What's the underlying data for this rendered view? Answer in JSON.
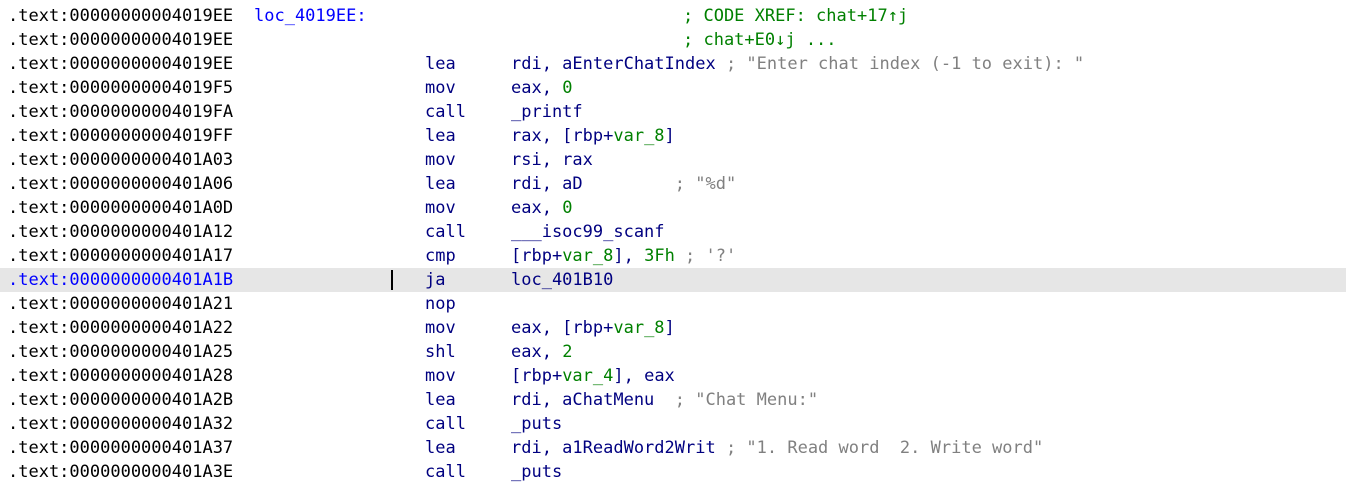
{
  "listing": {
    "rows": [
      {
        "addr": ".text:00000000004019EE",
        "label": "loc_4019EE:",
        "mn": "",
        "ops": [],
        "xref": "; CODE XREF: chat+17↑j"
      },
      {
        "addr": ".text:00000000004019EE",
        "label": "",
        "mn": "",
        "ops": [],
        "xref": "; chat+E0↓j ..."
      },
      {
        "addr": ".text:00000000004019EE",
        "label": "",
        "mn": "lea",
        "ops": [
          [
            "rdi, aEnterChatIndex ",
            "plain"
          ],
          [
            "; \"Enter chat index (-1 to exit): \"",
            "cmt"
          ]
        ],
        "xref": ""
      },
      {
        "addr": ".text:00000000004019F5",
        "label": "",
        "mn": "mov",
        "ops": [
          [
            "eax, ",
            "plain"
          ],
          [
            "0",
            "num"
          ]
        ],
        "xref": ""
      },
      {
        "addr": ".text:00000000004019FA",
        "label": "",
        "mn": "call",
        "ops": [
          [
            "_printf",
            "plain"
          ]
        ],
        "xref": ""
      },
      {
        "addr": ".text:00000000004019FF",
        "label": "",
        "mn": "lea",
        "ops": [
          [
            "rax, [rbp+",
            "plain"
          ],
          [
            "var_8",
            "var"
          ],
          [
            "]",
            "plain"
          ]
        ],
        "xref": ""
      },
      {
        "addr": ".text:0000000000401A03",
        "label": "",
        "mn": "mov",
        "ops": [
          [
            "rsi, rax",
            "plain"
          ]
        ],
        "xref": ""
      },
      {
        "addr": ".text:0000000000401A06",
        "label": "",
        "mn": "lea",
        "ops": [
          [
            "rdi, aD         ",
            "plain"
          ],
          [
            "; \"%d\"",
            "cmt"
          ]
        ],
        "xref": ""
      },
      {
        "addr": ".text:0000000000401A0D",
        "label": "",
        "mn": "mov",
        "ops": [
          [
            "eax, ",
            "plain"
          ],
          [
            "0",
            "num"
          ]
        ],
        "xref": ""
      },
      {
        "addr": ".text:0000000000401A12",
        "label": "",
        "mn": "call",
        "ops": [
          [
            "___isoc99_scanf",
            "plain"
          ]
        ],
        "xref": ""
      },
      {
        "addr": ".text:0000000000401A17",
        "label": "",
        "mn": "cmp",
        "ops": [
          [
            "[rbp+",
            "plain"
          ],
          [
            "var_8",
            "var"
          ],
          [
            "], ",
            "plain"
          ],
          [
            "3Fh",
            "num"
          ],
          [
            " ; '?'",
            "cmt"
          ]
        ],
        "xref": ""
      },
      {
        "addr": ".text:0000000000401A1B",
        "label": "",
        "mn": "ja",
        "ops": [
          [
            "loc_401B10",
            "plain"
          ]
        ],
        "xref": "",
        "selected": true
      },
      {
        "addr": ".text:0000000000401A21",
        "label": "",
        "mn": "nop",
        "ops": [],
        "xref": ""
      },
      {
        "addr": ".text:0000000000401A22",
        "label": "",
        "mn": "mov",
        "ops": [
          [
            "eax, [rbp+",
            "plain"
          ],
          [
            "var_8",
            "var"
          ],
          [
            "]",
            "plain"
          ]
        ],
        "xref": ""
      },
      {
        "addr": ".text:0000000000401A25",
        "label": "",
        "mn": "shl",
        "ops": [
          [
            "eax, ",
            "plain"
          ],
          [
            "2",
            "num"
          ]
        ],
        "xref": ""
      },
      {
        "addr": ".text:0000000000401A28",
        "label": "",
        "mn": "mov",
        "ops": [
          [
            "[rbp+",
            "plain"
          ],
          [
            "var_4",
            "var"
          ],
          [
            "], eax",
            "plain"
          ]
        ],
        "xref": ""
      },
      {
        "addr": ".text:0000000000401A2B",
        "label": "",
        "mn": "lea",
        "ops": [
          [
            "rdi, aChatMenu  ",
            "plain"
          ],
          [
            "; \"Chat Menu:\"",
            "cmt"
          ]
        ],
        "xref": ""
      },
      {
        "addr": ".text:0000000000401A32",
        "label": "",
        "mn": "call",
        "ops": [
          [
            "_puts",
            "plain"
          ]
        ],
        "xref": ""
      },
      {
        "addr": ".text:0000000000401A37",
        "label": "",
        "mn": "lea",
        "ops": [
          [
            "rdi, a1ReadWord2Writ ",
            "plain"
          ],
          [
            "; \"1. Read word  2. Write word\"",
            "cmt"
          ]
        ],
        "xref": ""
      },
      {
        "addr": ".text:0000000000401A3E",
        "label": "",
        "mn": "call",
        "ops": [
          [
            "_puts",
            "plain"
          ]
        ],
        "xref": ""
      }
    ]
  }
}
